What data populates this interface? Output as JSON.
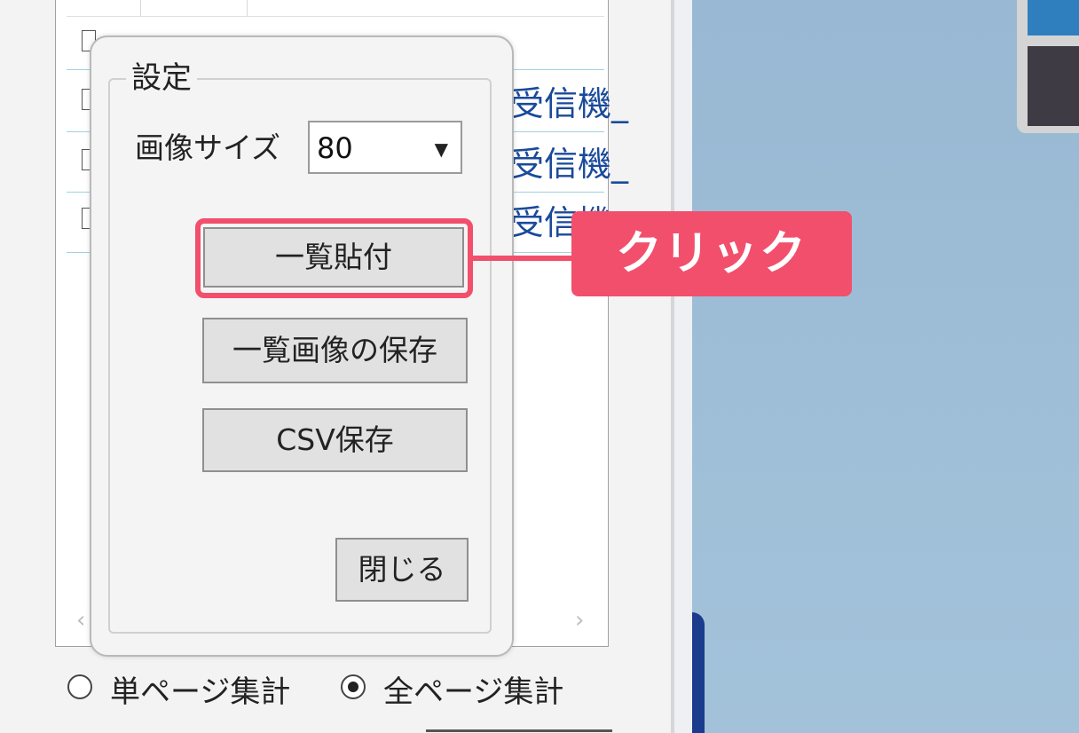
{
  "list": {
    "rows": [
      {
        "text": "受信機_"
      },
      {
        "text": "受信機_"
      },
      {
        "text": "受信機"
      }
    ],
    "scroll_left": "‹",
    "scroll_right": "›"
  },
  "dialog": {
    "group_title": "設定",
    "image_size_label": "画像サイズ",
    "image_size_value": "80",
    "buttons": {
      "paste": "一覧貼付",
      "save_image": "一覧画像の保存",
      "csv_save": "CSV保存",
      "close": "閉じる"
    }
  },
  "callout": {
    "text": "クリック",
    "color": "#f24f6c"
  },
  "aggregation": {
    "options": [
      {
        "label": "単ページ集計",
        "selected": false
      },
      {
        "label": "全ページ集計",
        "selected": true
      }
    ]
  }
}
